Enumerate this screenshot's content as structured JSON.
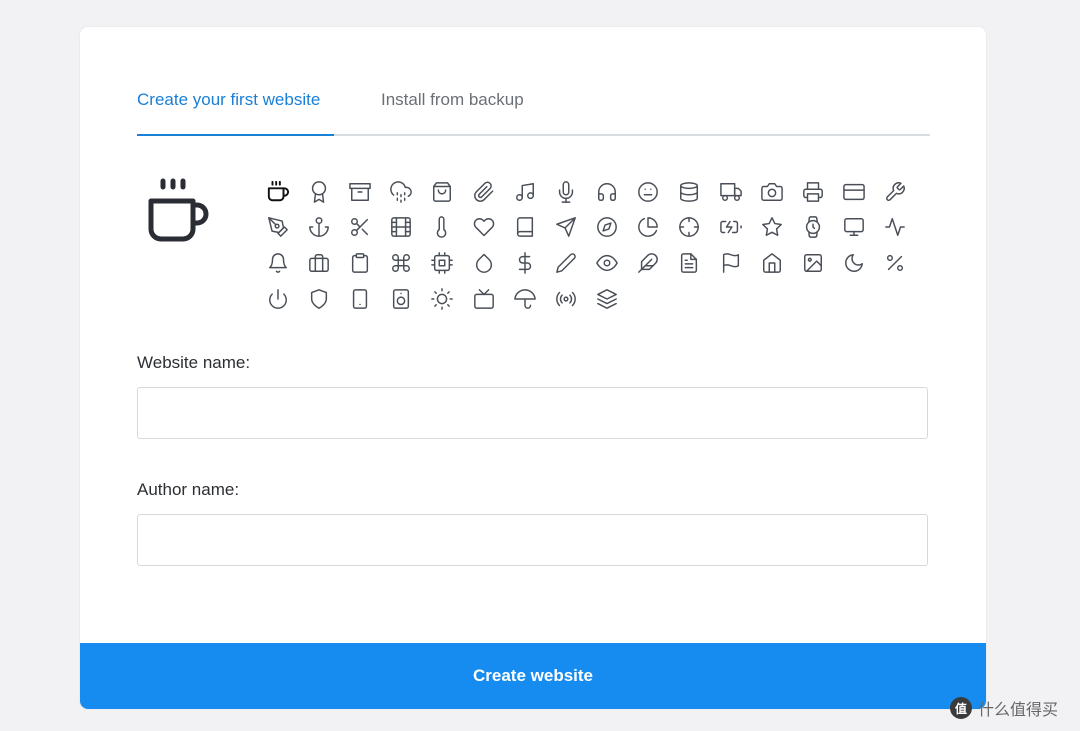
{
  "tabs": [
    {
      "label": "Create your first website",
      "active": true
    },
    {
      "label": "Install from backup",
      "active": false
    }
  ],
  "icon_picker": {
    "selected": "coffee",
    "icons": [
      "coffee",
      "award",
      "archive",
      "cloud-drizzle",
      "shopping-bag",
      "paperclip",
      "music",
      "mic",
      "headphones",
      "meh",
      "database",
      "truck",
      "camera",
      "printer",
      "credit-card",
      "tool",
      "pen-tool",
      "anchor",
      "scissors",
      "film",
      "thermometer",
      "heart",
      "book",
      "send",
      "compass",
      "pie-chart",
      "crosshair",
      "battery-charging",
      "star",
      "watch",
      "monitor",
      "activity",
      "bell",
      "briefcase",
      "clipboard",
      "command",
      "cpu",
      "droplet",
      "dollar-sign",
      "edit-2",
      "eye",
      "feather",
      "file-text",
      "flag",
      "home",
      "image",
      "moon",
      "percent",
      "power",
      "shield",
      "tablet",
      "speaker",
      "sun",
      "tv",
      "umbrella",
      "radio",
      "layers"
    ]
  },
  "form": {
    "website_name_label": "Website name:",
    "website_name_value": "",
    "author_name_label": "Author name:",
    "author_name_value": "",
    "submit_label": "Create website"
  },
  "watermark": {
    "logo": "值",
    "text": "什么值得买"
  },
  "colors": {
    "accent": "#1a7fd6",
    "button": "#168cf0"
  }
}
